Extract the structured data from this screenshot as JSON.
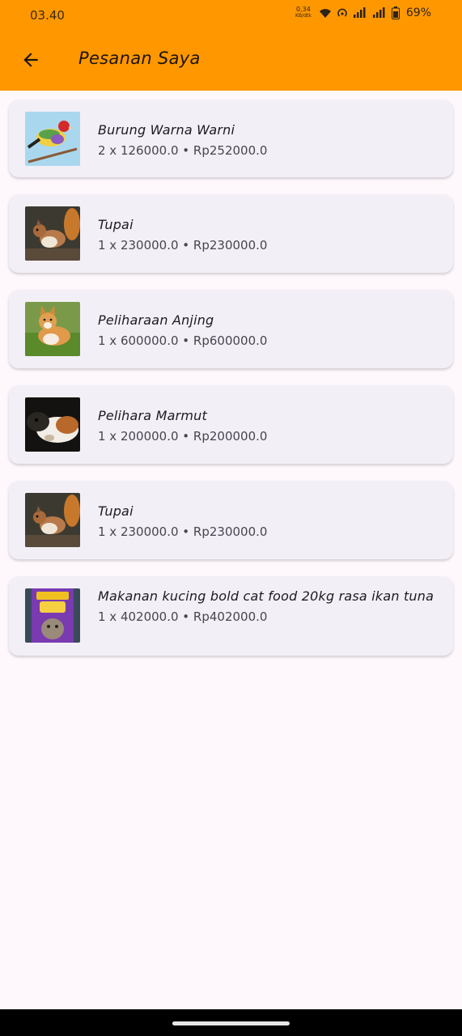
{
  "status_bar": {
    "time": "03.40",
    "net_speed": "0,34",
    "net_unit": "KB/dtk",
    "battery": "69%"
  },
  "app_bar": {
    "title": "Pesanan Saya",
    "back_icon": "arrow-left-icon",
    "background": "#ff9800"
  },
  "orders": [
    {
      "name": "Burung Warna Warni",
      "price": "2 x 126000.0 • Rp252000.0",
      "image": "bird"
    },
    {
      "name": "Tupai",
      "price": "1 x 230000.0 • Rp230000.0",
      "image": "squirrel"
    },
    {
      "name": "Peliharaan Anjing",
      "price": "1 x 600000.0 • Rp600000.0",
      "image": "dog"
    },
    {
      "name": "Pelihara Marmut",
      "price": "1 x 200000.0 • Rp200000.0",
      "image": "guinea-pig"
    },
    {
      "name": "Tupai",
      "price": "1 x 230000.0 • Rp230000.0",
      "image": "squirrel"
    },
    {
      "name": "Makanan kucing bold cat food 20kg rasa ikan tuna",
      "price": "1 x 402000.0 • Rp402000.0",
      "image": "cat-food"
    }
  ]
}
